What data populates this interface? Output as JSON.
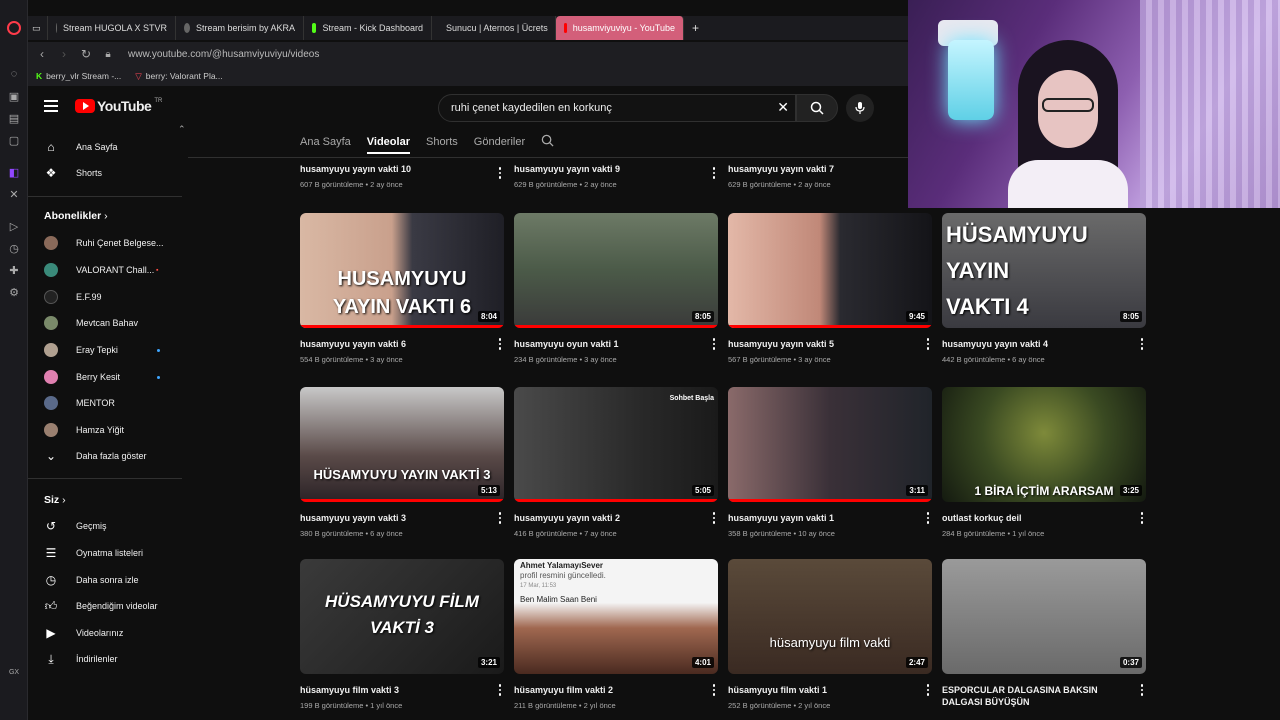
{
  "browser": {
    "tabs": [
      {
        "label": "Stream HUGOLA X STVR",
        "color": "#666"
      },
      {
        "label": "Stream berisim by AKRA",
        "color": "#666"
      },
      {
        "label": "Stream - Kick Dashboard",
        "color": "#53fc18"
      },
      {
        "label": "Sunucu | Aternos | Ücrets",
        "color": "#3a7bd5"
      },
      {
        "label": "husamviyuviyu - YouTube",
        "color": "#ff0000"
      }
    ],
    "new_tab": "+",
    "url": "www.youtube.com/@husamviyuviyu/videos",
    "bookmarks": [
      "berry_vlr Stream -...",
      "berry: Valorant Pla..."
    ],
    "rail_bottom": "GX"
  },
  "header": {
    "logo_text": "YouTube",
    "logo_region": "TR",
    "search_value": "ruhi çenet kaydedilen en korkunç"
  },
  "sidebar": {
    "main": [
      {
        "label": "Ana Sayfa",
        "icon": "home-icon"
      },
      {
        "label": "Shorts",
        "icon": "shorts-icon"
      }
    ],
    "subs_heading": "Abonelikler",
    "subs": [
      {
        "label": "Ruhi Çenet Belgese...",
        "color": "#8a6a5a",
        "dot": false
      },
      {
        "label": "VALORANT Chall...",
        "color": "#3a8a7a",
        "dot": false
      },
      {
        "label": "E.F.99",
        "color": "#222",
        "dot": false
      },
      {
        "label": "Mevtcan Bahav",
        "color": "#7a8a6a",
        "dot": false
      },
      {
        "label": "Eray Tepki",
        "color": "#b0a090",
        "dot": true
      },
      {
        "label": "Berry Kesit",
        "color": "#e080b0",
        "dot": true
      },
      {
        "label": "MENTOR",
        "color": "#5a6a8a",
        "dot": false
      },
      {
        "label": "Hamza Yiğit",
        "color": "#9a8070",
        "dot": false
      }
    ],
    "show_more": "Daha fazla göster",
    "you_heading": "Siz",
    "you": [
      {
        "label": "Geçmiş",
        "icon": "history-icon"
      },
      {
        "label": "Oynatma listeleri",
        "icon": "playlist-icon"
      },
      {
        "label": "Daha sonra izle",
        "icon": "clock-icon"
      },
      {
        "label": "Beğendiğim videolar",
        "icon": "like-icon"
      },
      {
        "label": "Videolarınız",
        "icon": "video-icon"
      },
      {
        "label": "İndirilenler",
        "icon": "download-icon"
      }
    ]
  },
  "channel_tabs": [
    "Ana Sayfa",
    "Videolar",
    "Shorts",
    "Gönderiler"
  ],
  "videos_top": [
    {
      "title": "husamyuyu yayın vakti 10",
      "meta": "607 B görüntüleme • 2 ay önce"
    },
    {
      "title": "husamyuyu yayın vakti 9",
      "meta": "629 B görüntüleme • 2 ay önce"
    },
    {
      "title": "husamyuyu yayın vakti 7",
      "meta": "629 B görüntüleme • 2 ay önce"
    }
  ],
  "videos": [
    {
      "title": "husamyuyu yayın vakti 6",
      "meta": "554 B görüntüleme • 3 ay önce",
      "duration": "8:04",
      "thumb_text": "HUSAMYUYU YAYIN VAKTI 6",
      "bg": "linear-gradient(90deg,#d9b8a4 0%,#c9a08c 45%,#3a3a44 55%,#1f1f26 100%)",
      "watched": 1.0
    },
    {
      "title": "husamyuyu oyun vakti 1",
      "meta": "234 B görüntüleme • 3 ay önce",
      "duration": "8:05",
      "thumb_text": "",
      "bg": "linear-gradient(180deg,#6d7a66 0%,#4b5a48 50%,#3a3a3a 100%)",
      "watched": 1.0
    },
    {
      "title": "husamyuyu yayın vakti 5",
      "meta": "567 B görüntüleme • 3 ay önce",
      "duration": "9:45",
      "thumb_text": "",
      "bg": "linear-gradient(90deg,#e3b8a8 0%,#c08878 45%,#2a2a30 55%,#141418 100%)",
      "watched": 1.0
    },
    {
      "title": "husamyuyu yayın vakti 4",
      "meta": "442 B görüntüleme • 6 ay önce",
      "duration": "8:05",
      "thumb_text": "HÜSAMYUYU YAYIN VAKTI 4",
      "bg": "linear-gradient(180deg,#6a6a6a 0%,#3a3a40 100%)",
      "watched": 0.0
    },
    {
      "title": "husamyuyu yayın vakti 3",
      "meta": "380 B görüntüleme • 6 ay önce",
      "duration": "5:13",
      "thumb_text": "HÜSAMYUYU YAYIN VAKTİ 3",
      "bg": "linear-gradient(180deg,#c8c8c8 0%,#5a4a48 60%,#2a2226 100%)",
      "watched": 1.0
    },
    {
      "title": "husamyuyu yayın vakti 2",
      "meta": "416 B görüntüleme • 7 ay önce",
      "duration": "5:05",
      "thumb_text": "",
      "bg": "linear-gradient(90deg,#4a4a4a 0%,#2a2a2a 60%,#1a1a1a 100%)",
      "watched": 1.0
    },
    {
      "title": "husamyuyu yayın vakti 1",
      "meta": "358 B görüntüleme • 10 ay önce",
      "duration": "3:11",
      "thumb_text": "",
      "bg": "linear-gradient(90deg,#8a6a6a 0%,#3a3038 50%,#20242a 100%)",
      "watched": 1.0
    },
    {
      "title": "outlast korkuç deil",
      "meta": "284 B görüntüleme • 1 yıl önce",
      "duration": "3:25",
      "thumb_text": "1 BİRA İÇTİM ARARSAM",
      "bg": "radial-gradient(circle at 50% 40%,#7e8a3a 0%,#3a4a22 50%,#141a10 100%)",
      "watched": 0.0
    },
    {
      "title": "hüsamyuyu film vakti 3",
      "meta": "199 B görüntüleme • 1 yıl önce",
      "duration": "3:21",
      "thumb_text": "HÜSAMYUYU FİLM VAKTİ 3",
      "bg": "linear-gradient(135deg,#3a3a3a 0%,#1a1a1a 100%)",
      "watched": 0.0
    },
    {
      "title": "hüsamyuyu film vakti 2",
      "meta": "211 B görüntüleme • 2 yıl önce",
      "duration": "4:01",
      "thumb_text": "",
      "bg": "linear-gradient(180deg,#f4f4f4 0%,#f4f4f4 38%,#a06850 60%,#4a2a20 100%)",
      "watched": 0.0
    },
    {
      "title": "hüsamyuyu film vakti 1",
      "meta": "252 B görüntüleme • 2 yıl önce",
      "duration": "2:47",
      "thumb_text": "hüsamyuyu film vakti",
      "bg": "linear-gradient(180deg,#5a4a3a 0%,#3a2a22 100%)",
      "watched": 0.0
    },
    {
      "title": "ESPORCULAR DALGASINA BAKSIN DALGASI BÜYÜŞÜN",
      "meta": "",
      "duration": "0:37",
      "thumb_text": "",
      "bg": "linear-gradient(180deg,#9a9a9a 0%,#6a6a6a 100%)",
      "watched": 0.0
    }
  ],
  "post_in_thumb": {
    "name": "Ahmet YalamayıSever",
    "action": "profil resmini güncelledi.",
    "date": "17 Mar, 11:53",
    "caption": "Ben Malim Saan Beni"
  },
  "chat_badge": "Sohbet Başla",
  "colors": {
    "accent": "#ff0000",
    "bg": "#0f0f0f",
    "dot": "#3ea6ff"
  }
}
